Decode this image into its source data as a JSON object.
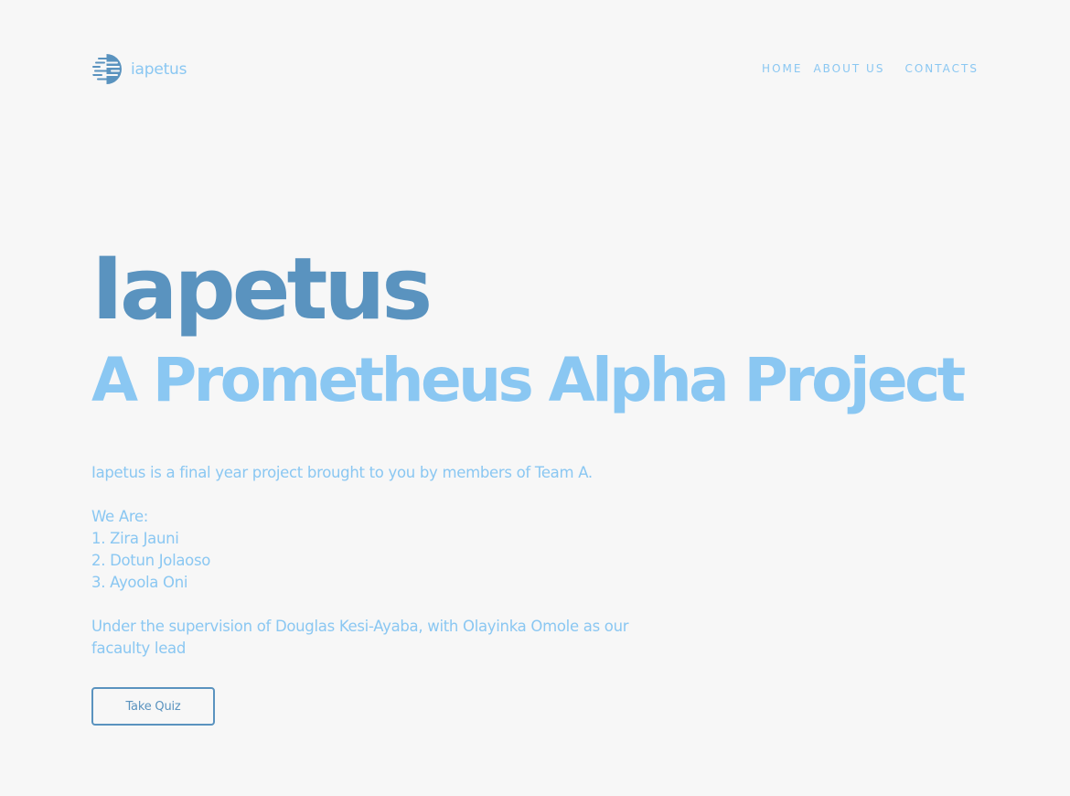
{
  "header": {
    "logo_icon": "iapetus-logo-icon",
    "logo_text": "iapetus",
    "nav": [
      {
        "label": "HOME"
      },
      {
        "label": "ABOUT US"
      },
      {
        "label": "CONTACTS"
      }
    ]
  },
  "hero": {
    "title": "Iapetus",
    "subtitle": "A Prometheus Alpha Project",
    "intro": "Iapetus is a final year project brought to you by members of Team A.",
    "members_heading": "We Are:",
    "members": [
      "1. Zira Jauni",
      "2. Dotun Jolaoso",
      "3. Ayoola Oni"
    ],
    "supervision": "Under the supervision of Douglas Kesi-Ayaba, with Olayinka Omole as our facaulty lead",
    "cta_label": "Take Quiz"
  },
  "colors": {
    "background": "#f7f7f7",
    "primary_dark": "#5a93bf",
    "primary_light": "#8ac7f2"
  }
}
